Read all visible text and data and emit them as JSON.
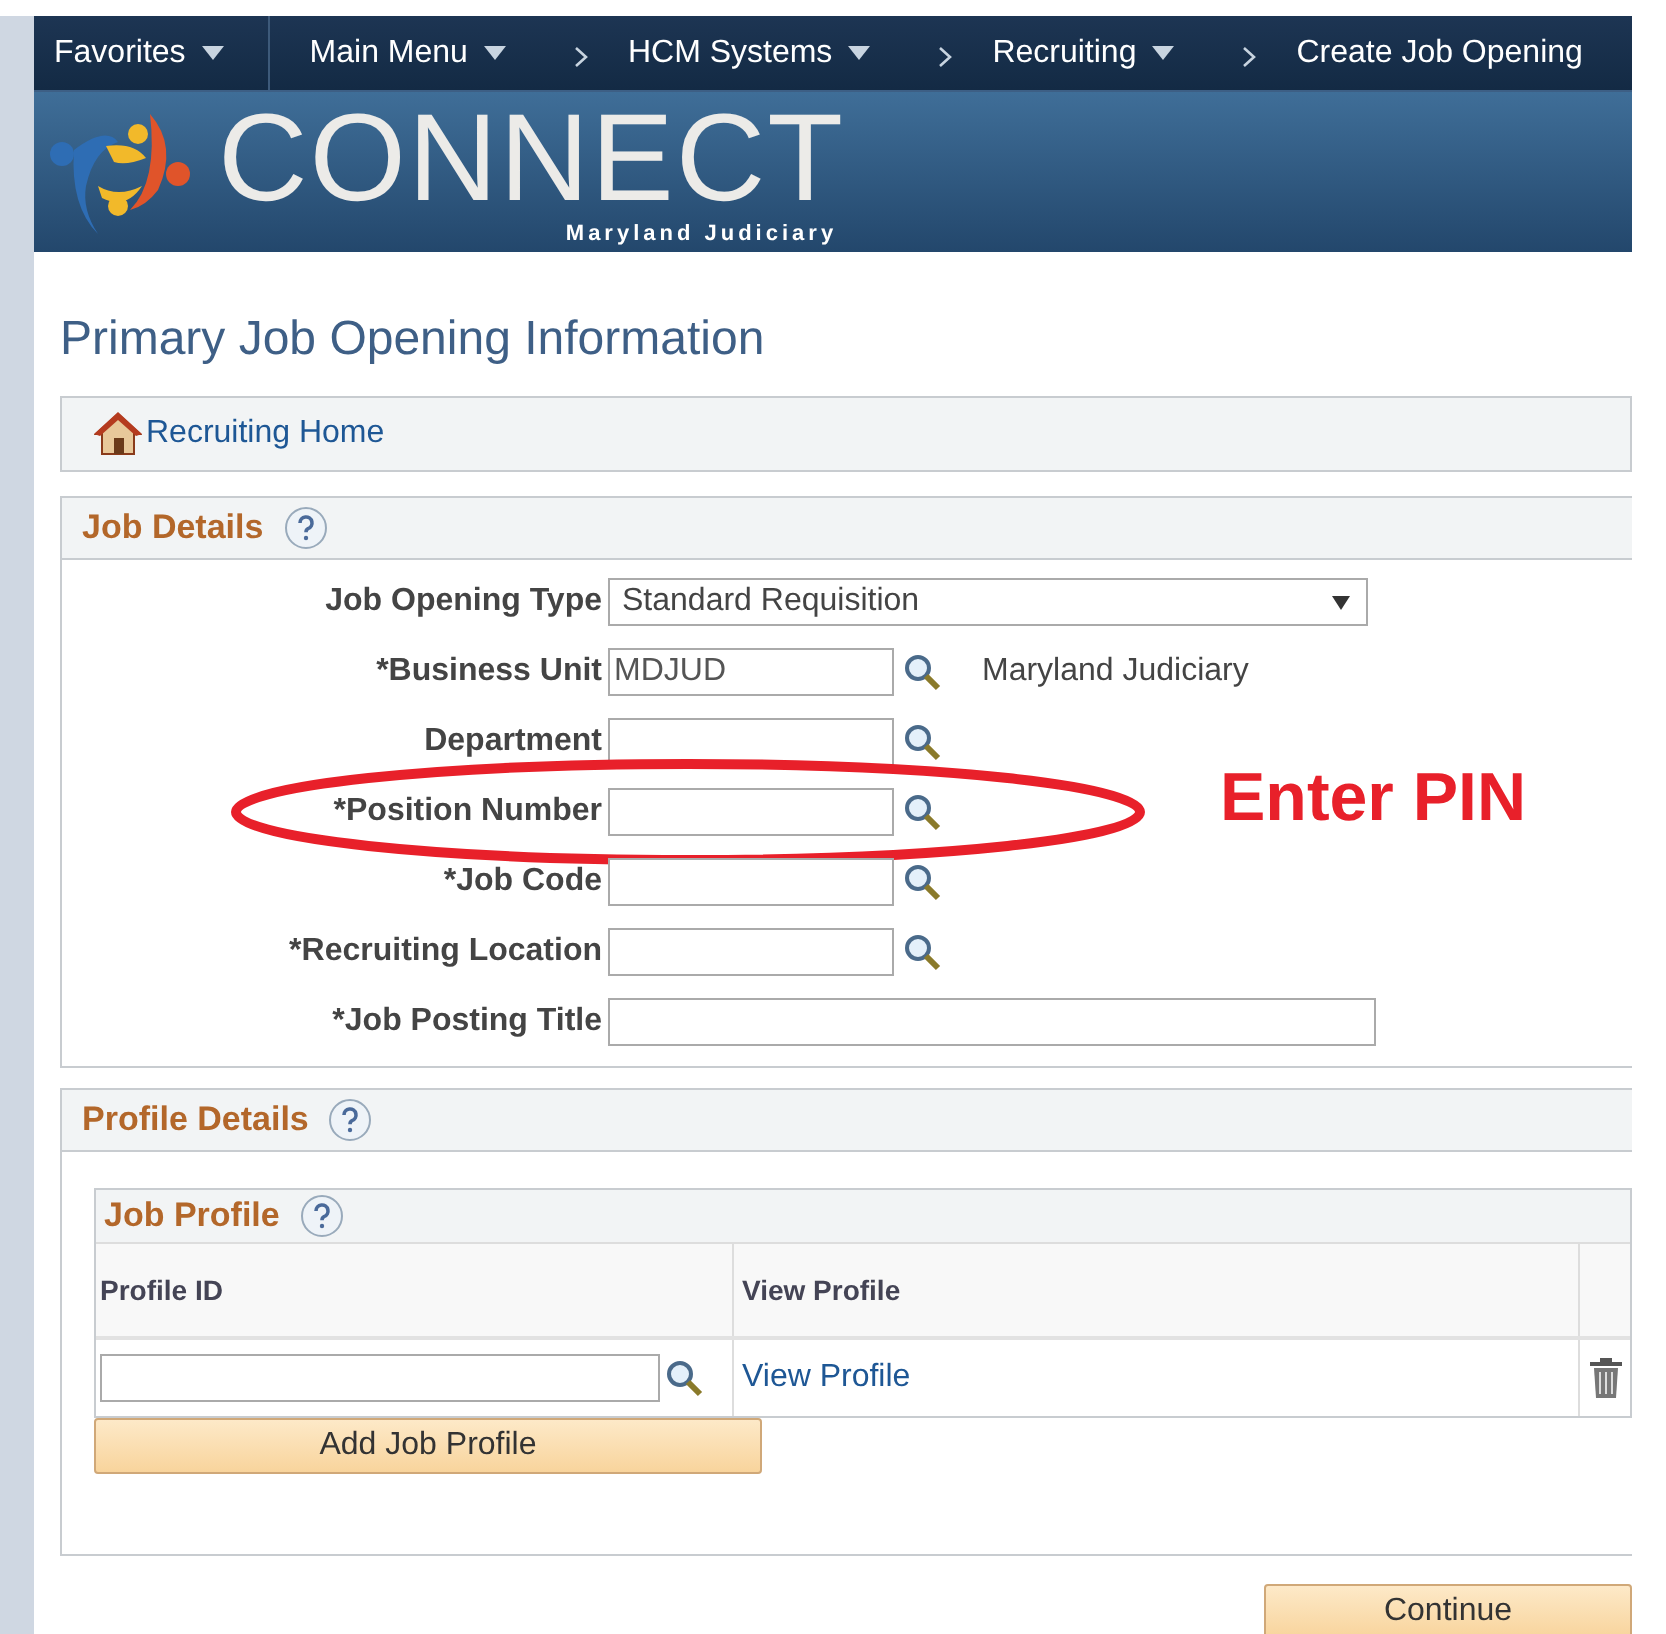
{
  "nav": [
    {
      "label": "Favorites",
      "caret": true,
      "separator": false
    },
    {
      "label": "Main Menu",
      "caret": true,
      "separator": false
    },
    {
      "label": "HCM Systems",
      "caret": true,
      "separator": true
    },
    {
      "label": "Recruiting",
      "caret": true,
      "separator": true
    },
    {
      "label": "Create Job Opening",
      "caret": false,
      "separator": true
    }
  ],
  "banner": {
    "logo": "CONNECT",
    "subtitle": "Maryland Judiciary"
  },
  "page_title": "Primary Job Opening Information",
  "home_link": "Recruiting Home",
  "job_details": {
    "title": "Job Details",
    "fields": [
      {
        "kind": "select",
        "label": "Job Opening Type",
        "value": "Standard Requisition",
        "highlighted": false
      },
      {
        "kind": "lookup",
        "label": "*Business Unit",
        "value": "MDJUD",
        "description": "Maryland Judiciary",
        "highlighted": false
      },
      {
        "kind": "lookup",
        "label": "Department",
        "highlighted": false
      },
      {
        "kind": "lookup",
        "label": "*Position Number",
        "highlighted": true
      },
      {
        "kind": "lookup",
        "label": "*Job Code",
        "highlighted": false
      },
      {
        "kind": "lookup",
        "label": "*Recruiting Location",
        "highlighted": false
      },
      {
        "kind": "text",
        "label": "*Job Posting Title",
        "highlighted": false
      }
    ],
    "annotation": "Enter PIN"
  },
  "profile_details": {
    "title": "Profile Details",
    "job_profile": {
      "title": "Job Profile",
      "columns": [
        "Profile ID",
        "View Profile"
      ],
      "rows": [
        {
          "link": "View Profile"
        }
      ],
      "add_button": "Add Job Profile"
    }
  },
  "continue_button": "Continue"
}
